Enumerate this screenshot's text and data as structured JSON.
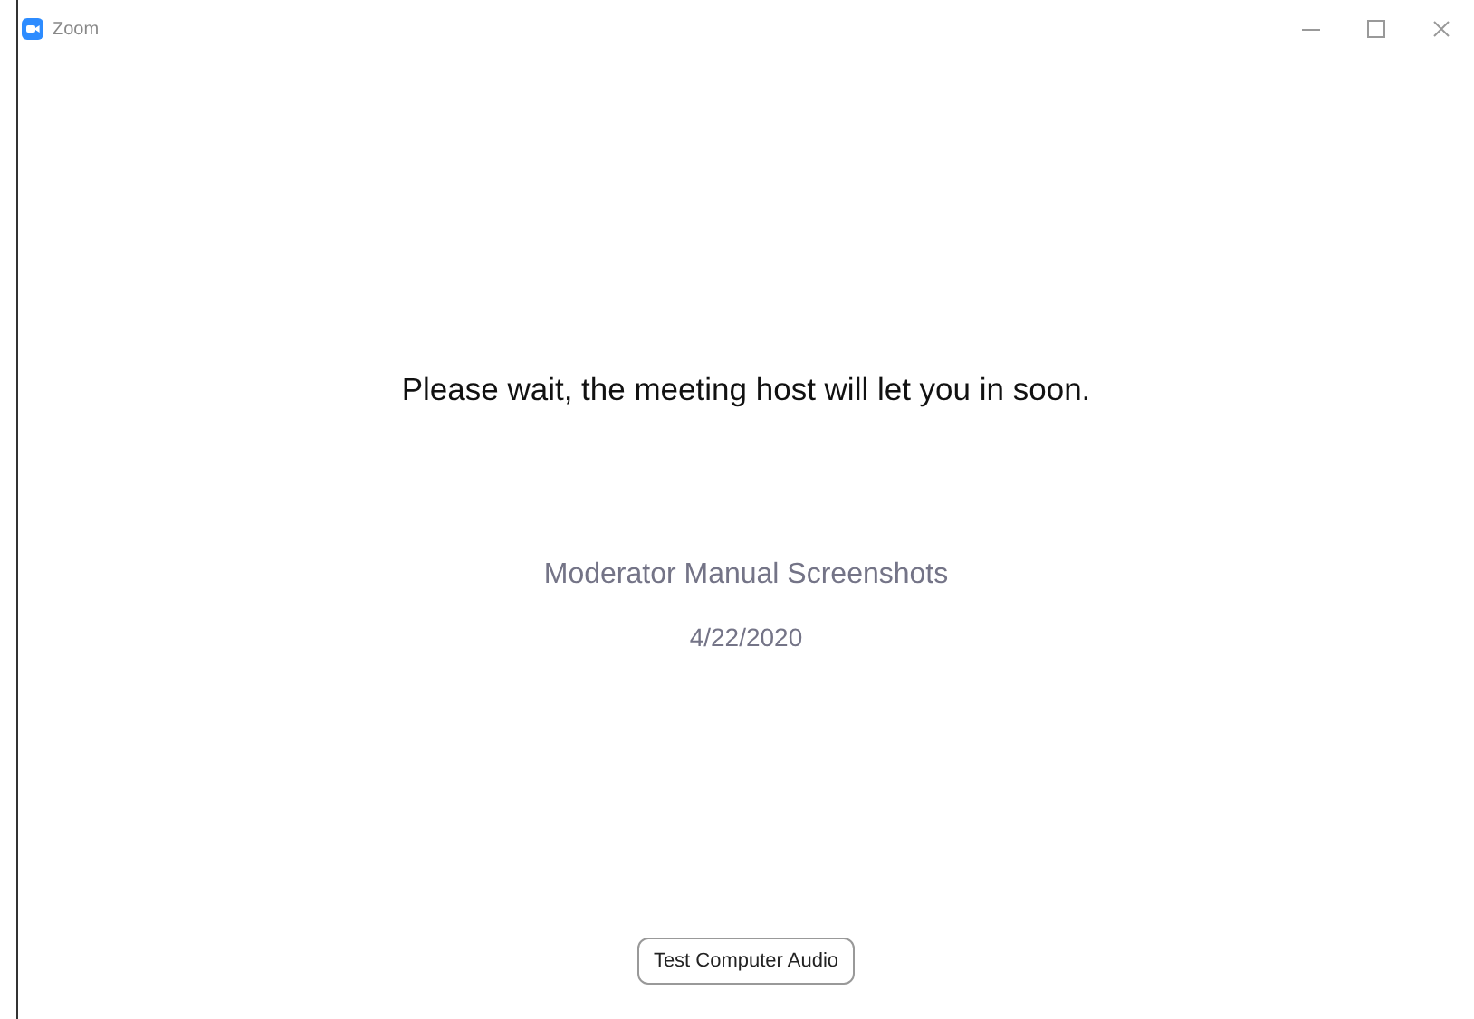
{
  "window": {
    "title": "Zoom"
  },
  "message": "Please wait, the meeting host will let you in soon.",
  "meeting": {
    "topic": "Moderator Manual Screenshots",
    "date": "4/22/2020"
  },
  "buttons": [
    "Test Computer Audio"
  ]
}
